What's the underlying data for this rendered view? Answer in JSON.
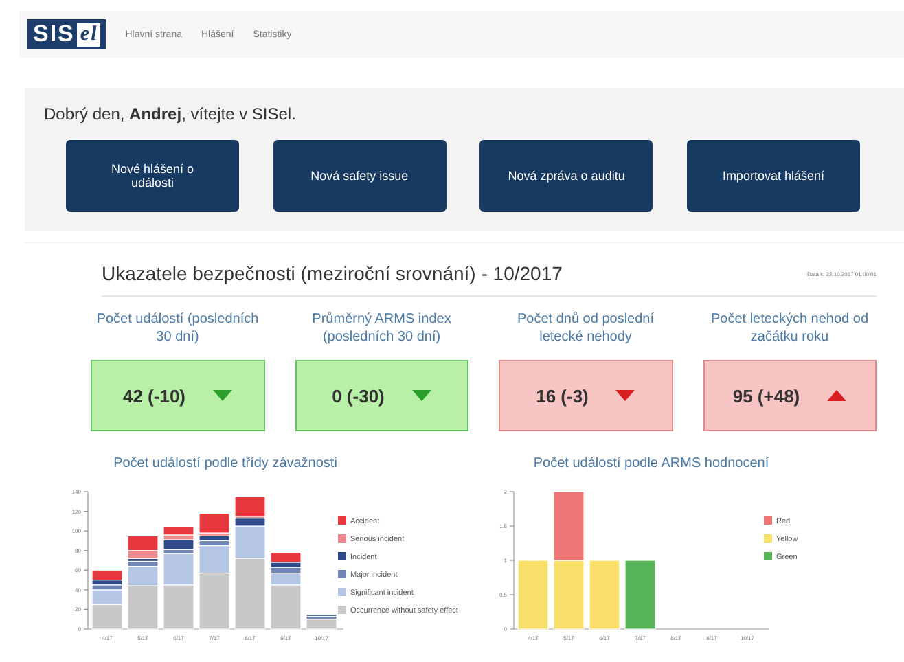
{
  "nav": {
    "logo_main": "SIS",
    "logo_accent": "el",
    "links": [
      "Hlavní strana",
      "Hlášení",
      "Statistiky"
    ]
  },
  "greeting": "Dobrý den, **Andrej**, vítejte v SISel.",
  "actions": [
    "Nové hlášení o události",
    "Nová safety issue",
    "Nová zpráva o auditu",
    "Importovat hlášení"
  ],
  "dashboard": {
    "title": "Ukazatele bezpečnosti (meziroční srovnání) - 10/2017",
    "timestamp": "Data k: 22.10.2017 01:00:01",
    "kpis": [
      {
        "label": "Počet událostí (posledních 30 dní)",
        "value": "42 (-10)",
        "rising": false,
        "positive": true
      },
      {
        "label": "Průměrný ARMS index (posledních 30 dní)",
        "value": "0 (-30)",
        "rising": false,
        "positive": true
      },
      {
        "label": "Počet dnů od poslední letecké nehody",
        "value": "16 (-3)",
        "rising": false,
        "positive": false
      },
      {
        "label": "Počet leteckých nehod od začátku roku",
        "value": "95 (+48)",
        "rising": true,
        "positive": false
      }
    ],
    "charts": [
      {
        "chart_data": {
          "type": "bar",
          "title": "Počet událostí podle třídy závažnosti",
          "stacked": true,
          "legend": "right",
          "categories": [
            "4/17",
            "5/17",
            "6/17",
            "7/17",
            "8/17",
            "9/17",
            "10/17"
          ],
          "ylim": [
            0,
            140
          ],
          "yticks": [
            0,
            20,
            40,
            60,
            80,
            100,
            120,
            140
          ],
          "series": [
            {
              "name": "Occurrence without safety effect",
              "color": "#c8c8c8",
              "values": [
                25,
                44,
                45,
                57,
                72,
                45,
                10
              ]
            },
            {
              "name": "Significant incident",
              "color": "#b4c6e4",
              "values": [
                15,
                20,
                32,
                28,
                33,
                12,
                0
              ]
            },
            {
              "name": "Major incident",
              "color": "#7185b5",
              "values": [
                5,
                5,
                4,
                5,
                0,
                6,
                3
              ]
            },
            {
              "name": "Incident",
              "color": "#2e4a8a",
              "values": [
                5,
                3,
                10,
                5,
                8,
                5,
                2
              ]
            },
            {
              "name": "Serious incident",
              "color": "#ee8a8e",
              "values": [
                0,
                8,
                5,
                3,
                2,
                0,
                0
              ]
            },
            {
              "name": "Accident",
              "color": "#e8393f",
              "values": [
                10,
                15,
                8,
                20,
                20,
                10,
                0
              ]
            }
          ]
        }
      },
      {
        "chart_data": {
          "type": "bar",
          "title": "Počet událostí podle ARMS hodnocení",
          "stacked": true,
          "legend": "right",
          "categories": [
            "4/17",
            "5/17",
            "6/17",
            "7/17",
            "8/17",
            "9/17",
            "10/17"
          ],
          "ylim": [
            0,
            2
          ],
          "yticks": [
            0,
            0.5,
            1,
            1.5,
            2
          ],
          "series": [
            {
              "name": "Green",
              "color": "#58b55a",
              "values": [
                0,
                0,
                0,
                1,
                0,
                0,
                0
              ]
            },
            {
              "name": "Yellow",
              "color": "#f7df6a",
              "values": [
                1,
                1,
                1,
                0,
                0,
                0,
                0
              ]
            },
            {
              "name": "Red",
              "color": "#f07575",
              "values": [
                0,
                1,
                0,
                0,
                0,
                0,
                0
              ]
            }
          ]
        }
      }
    ]
  }
}
